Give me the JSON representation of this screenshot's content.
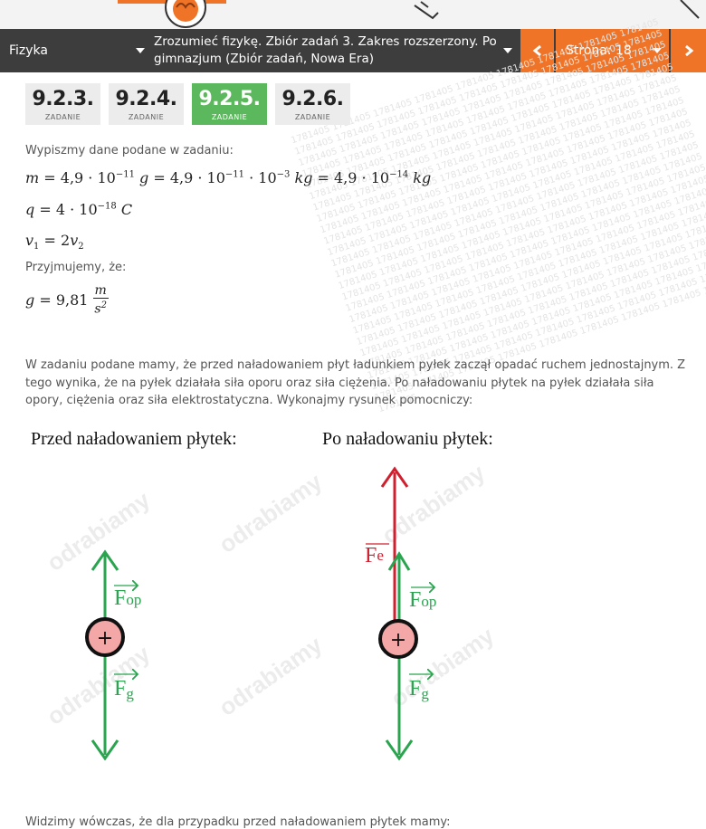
{
  "nav": {
    "subject": "Fizyka",
    "book_line1": "Zrozumieć fizykę. Zbiór zadań 3. Zakres rozszerzony. Po",
    "book_line2": "gimnazjum (Zbiór zadań, Nowa Era)",
    "page_label": "Strona: 18",
    "prev_icon": "chevron-left-icon",
    "next_icon": "chevron-right-icon"
  },
  "tasks": [
    {
      "num": "9.2.3.",
      "label": "ZADANIE",
      "active": false
    },
    {
      "num": "9.2.4.",
      "label": "ZADANIE",
      "active": false
    },
    {
      "num": "9.2.5.",
      "label": "ZADANIE",
      "active": true
    },
    {
      "num": "9.2.6.",
      "label": "ZADANIE",
      "active": false
    }
  ],
  "content": {
    "given_intro": "Wypiszmy dane podane w zadaniu:",
    "assume": "Przyjmujemy, że:",
    "explanation": "W zadaniu podane mamy, że przed naładowaniem płyt ładunkiem pyłek zaczął opadać ruchem jednostajnym. Z tego wynika, że na pyłek działała siła oporu oraz siła ciężenia. Po naładowaniu płytek na pyłek działała siła opory, ciężenia oraz siła elektrostatyczna. Wykonajmy rysunek pomocniczy:",
    "bottom": "Widzimy wówczas, że dla przypadku przed naładowaniem płytek mamy:"
  },
  "diagram": {
    "before_title": "Przed naładowaniem płytek:",
    "after_title": "Po naładowaniu płytek:",
    "force_op": "F",
    "force_op_sub": "op",
    "force_g": "F",
    "force_g_sub": "g",
    "force_e": "F",
    "force_e_sub": "e",
    "charge": "+",
    "watermark": "odrabiamy"
  },
  "colors": {
    "accent": "#f07427",
    "navbar": "#3d3d3d",
    "active_tile": "#5cb85c",
    "green_arrow": "#2aa44f",
    "red_arrow": "#d0202f",
    "charge_fill": "#f4a7a7"
  }
}
